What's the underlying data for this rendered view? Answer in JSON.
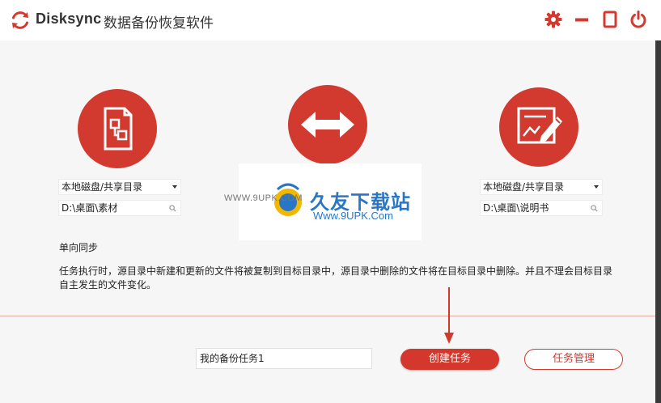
{
  "titlebar": {
    "brand": "Disksync",
    "title": "数据备份恢复软件",
    "icons": [
      "sync-logo-icon",
      "gear-icon",
      "minimize-icon",
      "maximize-icon",
      "power-icon"
    ]
  },
  "source": {
    "select_value": "本地磁盘/共享目录",
    "path_value": "D:\\桌面\\素材"
  },
  "target": {
    "select_value": "本地磁盘/共享目录",
    "path_value": "D:\\桌面\\说明书"
  },
  "mode": {
    "label": "单向同步",
    "description": "任务执行时，源目录中新建和更新的文件将被复制到目标目录中，源目录中删除的文件将在目标目录中删除。并且不理会目标目录自主发生的文件变化。"
  },
  "footer": {
    "task_name": "我的备份任务1",
    "create_label": "创建任务",
    "manage_label": "任务管理"
  },
  "watermark": {
    "main": "久友下载站",
    "url": "Www.9UPK.Com",
    "left": "WWW.9UPK.COM"
  },
  "colors": {
    "accent": "#d33a2f",
    "background": "#f6f6f6"
  }
}
